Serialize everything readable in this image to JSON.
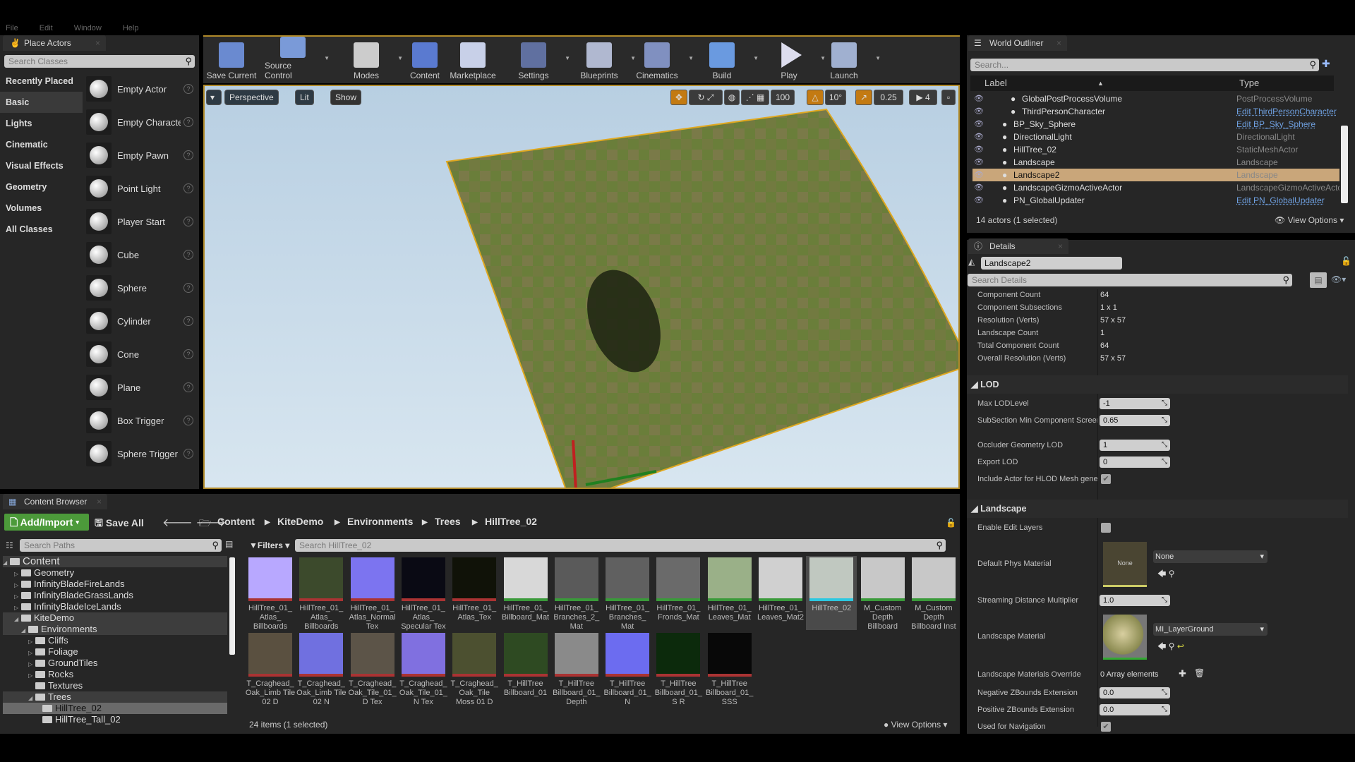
{
  "menu": [
    "File",
    "Edit",
    "Window",
    "Help"
  ],
  "place_actors": {
    "tab": "Place Actors",
    "search_placeholder": "Search Classes",
    "categories": [
      "Recently Placed",
      "Basic",
      "Lights",
      "Cinematic",
      "Visual Effects",
      "Geometry",
      "Volumes",
      "All Classes"
    ],
    "selected_category": "Basic",
    "items": [
      "Empty Actor",
      "Empty Character",
      "Empty Pawn",
      "Point Light",
      "Player Start",
      "Cube",
      "Sphere",
      "Cylinder",
      "Cone",
      "Plane",
      "Box Trigger",
      "Sphere Trigger"
    ]
  },
  "toolbar": [
    {
      "label": "Save Current",
      "icon": "save-icon",
      "dd": false
    },
    {
      "label": "Source Control",
      "icon": "source-control-icon",
      "dd": true
    },
    {
      "label": "Modes",
      "icon": "modes-icon",
      "dd": true
    },
    {
      "label": "Content",
      "icon": "content-icon",
      "dd": false
    },
    {
      "label": "Marketplace",
      "icon": "marketplace-icon",
      "dd": false
    },
    {
      "label": "Settings",
      "icon": "settings-icon",
      "dd": true
    },
    {
      "label": "Blueprints",
      "icon": "blueprints-icon",
      "dd": true
    },
    {
      "label": "Cinematics",
      "icon": "cinematics-icon",
      "dd": true
    },
    {
      "label": "Build",
      "icon": "build-icon",
      "dd": true
    },
    {
      "label": "Play",
      "icon": "play-icon",
      "dd": true
    },
    {
      "label": "Launch",
      "icon": "launch-icon",
      "dd": true
    }
  ],
  "viewport": {
    "perspective": "Perspective",
    "lit": "Lit",
    "show": "Show",
    "grid_snap": "100",
    "rot_snap": "10°",
    "scale_snap": "0.25",
    "camera_speed": "4"
  },
  "outliner": {
    "tab": "World Outliner",
    "search_placeholder": "Search...",
    "col_label": "Label",
    "col_type": "Type",
    "rows": [
      {
        "label": "GlobalPostProcessVolume",
        "type": "PostProcessVolume",
        "link": false,
        "indent": 2
      },
      {
        "label": "ThirdPersonCharacter",
        "type": "Edit ThirdPersonCharacter",
        "link": true,
        "indent": 2
      },
      {
        "label": "BP_Sky_Sphere",
        "type": "Edit BP_Sky_Sphere",
        "link": true,
        "indent": 1
      },
      {
        "label": "DirectionalLight",
        "type": "DirectionalLight",
        "link": false,
        "indent": 1
      },
      {
        "label": "HillTree_02",
        "type": "StaticMeshActor",
        "link": false,
        "indent": 1
      },
      {
        "label": "Landscape",
        "type": "Landscape",
        "link": false,
        "indent": 1
      },
      {
        "label": "Landscape2",
        "type": "Landscape",
        "link": false,
        "indent": 1,
        "selected": true
      },
      {
        "label": "LandscapeGizmoActiveActor",
        "type": "LandscapeGizmoActiveActor",
        "link": false,
        "indent": 1
      },
      {
        "label": "PN_GlobalUpdater",
        "type": "Edit PN_GlobalUpdater",
        "link": true,
        "indent": 1
      }
    ],
    "status": "14 actors (1 selected)",
    "view_options": "View Options"
  },
  "details": {
    "tab": "Details",
    "name": "Landscape2",
    "search_placeholder": "Search Details",
    "info": [
      [
        "Component Count",
        "64"
      ],
      [
        "Component Subsections",
        "1 x 1"
      ],
      [
        "Resolution (Verts)",
        "57 x 57"
      ],
      [
        "Landscape Count",
        "1"
      ],
      [
        "Total Component Count",
        "64"
      ],
      [
        "Overall Resolution (Verts)",
        "57 x 57"
      ]
    ],
    "lod": {
      "title": "LOD",
      "max_lod_label": "Max LODLevel",
      "max_lod": "-1",
      "subsection_label": "SubSection Min Component Screen Size",
      "subsection": "0.65",
      "occluder_label": "Occluder Geometry LOD",
      "occluder": "1",
      "export_label": "Export LOD",
      "export": "0",
      "hlod_label": "Include Actor for HLOD Mesh generation",
      "hlod": true
    },
    "landscape": {
      "title": "Landscape",
      "edit_layers_label": "Enable Edit Layers",
      "edit_layers": false,
      "phys_label": "Default Phys Material",
      "phys_thumb": "None",
      "phys_value": "None",
      "stream_label": "Streaming Distance Multiplier",
      "stream": "1.0",
      "mat_label": "Landscape Material",
      "mat_value": "MI_LayerGround",
      "override_label": "Landscape Materials Override",
      "override": "0 Array elements",
      "negz_label": "Negative ZBounds Extension",
      "negz": "0.0",
      "posz_label": "Positive ZBounds Extension",
      "posz": "0.0",
      "nav_label": "Used for Navigation",
      "nav": true
    }
  },
  "content_browser": {
    "tab": "Content Browser",
    "add_import": "Add/Import",
    "save_all": "Save All",
    "breadcrumb": [
      "Content",
      "KiteDemo",
      "Environments",
      "Trees",
      "HillTree_02"
    ],
    "paths_placeholder": "Search Paths",
    "filters": "Filters",
    "search_placeholder": "Search HillTree_02",
    "tree": [
      {
        "label": "Content",
        "d": 0,
        "open": true,
        "hl": true
      },
      {
        "label": "Geometry",
        "d": 1
      },
      {
        "label": "InfinityBladeFireLands",
        "d": 1
      },
      {
        "label": "InfinityBladeGrassLands",
        "d": 1
      },
      {
        "label": "InfinityBladeIceLands",
        "d": 1
      },
      {
        "label": "KiteDemo",
        "d": 1,
        "open": true,
        "hl": true
      },
      {
        "label": "Environments",
        "d": 2,
        "open": true,
        "hl": true
      },
      {
        "label": "Cliffs",
        "d": 3
      },
      {
        "label": "Foliage",
        "d": 3
      },
      {
        "label": "GroundTiles",
        "d": 3
      },
      {
        "label": "Rocks",
        "d": 3
      },
      {
        "label": "Textures",
        "d": 3,
        "leaf": true
      },
      {
        "label": "Trees",
        "d": 3,
        "open": true,
        "hl": true
      },
      {
        "label": "HillTree_02",
        "d": 4,
        "sel": true
      },
      {
        "label": "HillTree_Tall_02",
        "d": 4
      }
    ],
    "assets": [
      {
        "name": "HillTree_01_ Atlas_ Billboards",
        "color": "#b8a8ff",
        "type": "texture"
      },
      {
        "name": "HillTree_01_ Atlas_ Billboards",
        "color": "#3c4a2c",
        "type": "texture"
      },
      {
        "name": "HillTree_01_ Atlas_Normal Tex",
        "color": "#7c74f0",
        "type": "texture"
      },
      {
        "name": "HillTree_01_ Atlas_ Specular Tex",
        "color": "#0a0a14",
        "type": "texture"
      },
      {
        "name": "HillTree_01_ Atlas_Tex",
        "color": "#101208",
        "type": "texture"
      },
      {
        "name": "HillTree_01_ Billboard_Mat",
        "color": "#d8d8d8",
        "type": "material"
      },
      {
        "name": "HillTree_01_ Branches_2_ Mat",
        "color": "#5a5a5a",
        "type": "material"
      },
      {
        "name": "HillTree_01_ Branches_ Mat",
        "color": "#606060",
        "type": "material"
      },
      {
        "name": "HillTree_01_ Fronds_Mat",
        "color": "#6a6a6a",
        "type": "material"
      },
      {
        "name": "HillTree_01_ Leaves_Mat",
        "color": "#9ab088",
        "type": "material"
      },
      {
        "name": "HillTree_01_ Leaves_Mat2",
        "color": "#d0d0d0",
        "type": "material"
      },
      {
        "name": "HillTree_02",
        "color": "#c0c8c0",
        "type": "mesh",
        "selected": true
      },
      {
        "name": "M_Custom Depth Billboard",
        "color": "#c8c8c8",
        "type": "material"
      },
      {
        "name": "M_Custom Depth Billboard Inst",
        "color": "#c8c8c8",
        "type": "material"
      },
      {
        "name": "T_Craghead_ Oak_Limb Tile 02 D",
        "color": "#5a5040",
        "type": "texture"
      },
      {
        "name": "T_Craghead_ Oak_Limb Tile 02 N",
        "color": "#7070e0",
        "type": "texture"
      },
      {
        "name": "T_Craghead_ Oak_Tile_01_ D Tex",
        "color": "#5c5448",
        "type": "texture"
      },
      {
        "name": "T_Craghead_ Oak_Tile_01_ N Tex",
        "color": "#8070e0",
        "type": "texture"
      },
      {
        "name": "T_Craghead_ Oak_Tile Moss 01 D",
        "color": "#4c5030",
        "type": "texture"
      },
      {
        "name": "T_HillTree Billboard_01",
        "color": "#2e4a22",
        "type": "texture"
      },
      {
        "name": "T_HillTree Billboard_01_ Depth",
        "color": "#8a8a8a",
        "type": "texture"
      },
      {
        "name": "T_HillTree Billboard_01_ N",
        "color": "#6c6cf0",
        "type": "texture"
      },
      {
        "name": "T_HillTree Billboard_01_ S R",
        "color": "#0c2a0c",
        "type": "texture"
      },
      {
        "name": "T_HillTree Billboard_01_ SSS",
        "color": "#080808",
        "type": "texture"
      }
    ],
    "status": "24 items (1 selected)",
    "view_options": "View Options"
  },
  "colors": {
    "accent_orange": "#c37a12",
    "selection": "#c9a67a",
    "add_green": "#4c9a3a",
    "texture_strip": "#a33",
    "material_strip": "#3a9a3a",
    "mesh_strip": "#2cc8e0"
  }
}
